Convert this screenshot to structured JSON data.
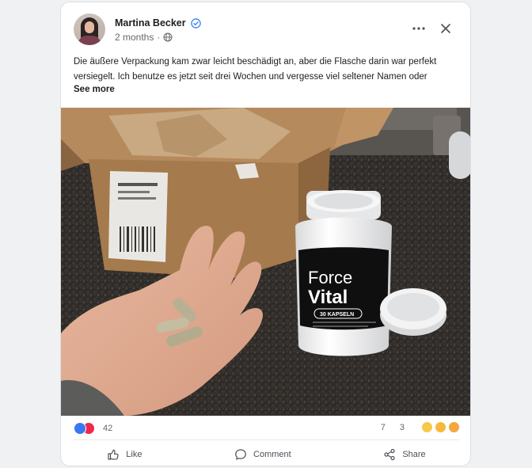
{
  "post": {
    "author_name": "Martina Becker",
    "time": "2 months",
    "meta_separator": "·",
    "text": "Die äußere Verpackung kam zwar leicht beschädigt an, aber die Flasche darin war perfekt versiegelt. Ich benutze es jetzt seit drei Wochen und vergesse viel seltener Namen oder",
    "see_more": "See more",
    "icons": {
      "verified": "verified-badge-icon",
      "audience": "globe-icon",
      "more": "more-options-icon",
      "close": "close-icon"
    }
  },
  "photo": {
    "bottle_brand_line1": "Force",
    "bottle_brand_line2": "Vital",
    "bottle_capsules": "30 KAPSELN"
  },
  "stats": {
    "reactions_count": "42",
    "comments_count": "7",
    "shares_count": "3",
    "reaction_icons": [
      "like",
      "love"
    ],
    "emoji_icons": [
      "grinning-face",
      "laughing-face",
      "heart-eyes-face"
    ]
  },
  "actions": {
    "like": "Like",
    "comment": "Comment",
    "share": "Share"
  },
  "colors": {
    "verified": "#3b82f6",
    "like": "#3a78f2",
    "love": "#f0284a",
    "text": "#1c1e21",
    "muted": "#65676b"
  }
}
